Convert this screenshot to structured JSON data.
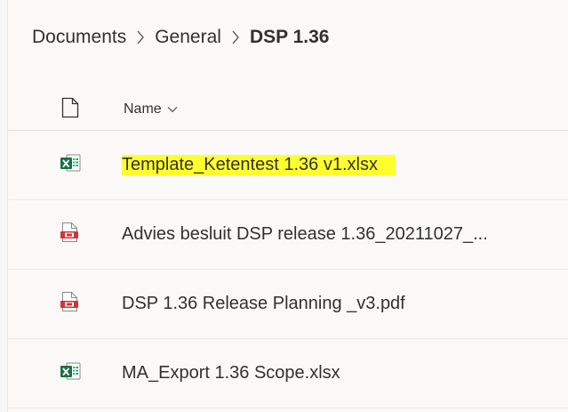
{
  "breadcrumb": {
    "items": [
      "Documents",
      "General"
    ],
    "current": "DSP 1.36"
  },
  "header": {
    "file_type_icon": "document-outline-icon",
    "name_label": "Name",
    "sort_icon": "chevron-down-icon"
  },
  "files": [
    {
      "name": "Template_Ketentest 1.36 v1.xlsx",
      "icon": "excel-icon",
      "highlighted": true
    },
    {
      "name": "Advies besluit DSP release 1.36_20211027_...",
      "icon": "pdf-icon",
      "highlighted": false
    },
    {
      "name": "DSP 1.36 Release Planning _v3.pdf",
      "icon": "pdf-icon",
      "highlighted": false
    },
    {
      "name": "MA_Export 1.36 Scope.xlsx",
      "icon": "excel-icon",
      "highlighted": false
    }
  ],
  "colors": {
    "highlight": "#ffff2e",
    "excel_green": "#1e7145",
    "pdf_red": "#d13438"
  }
}
